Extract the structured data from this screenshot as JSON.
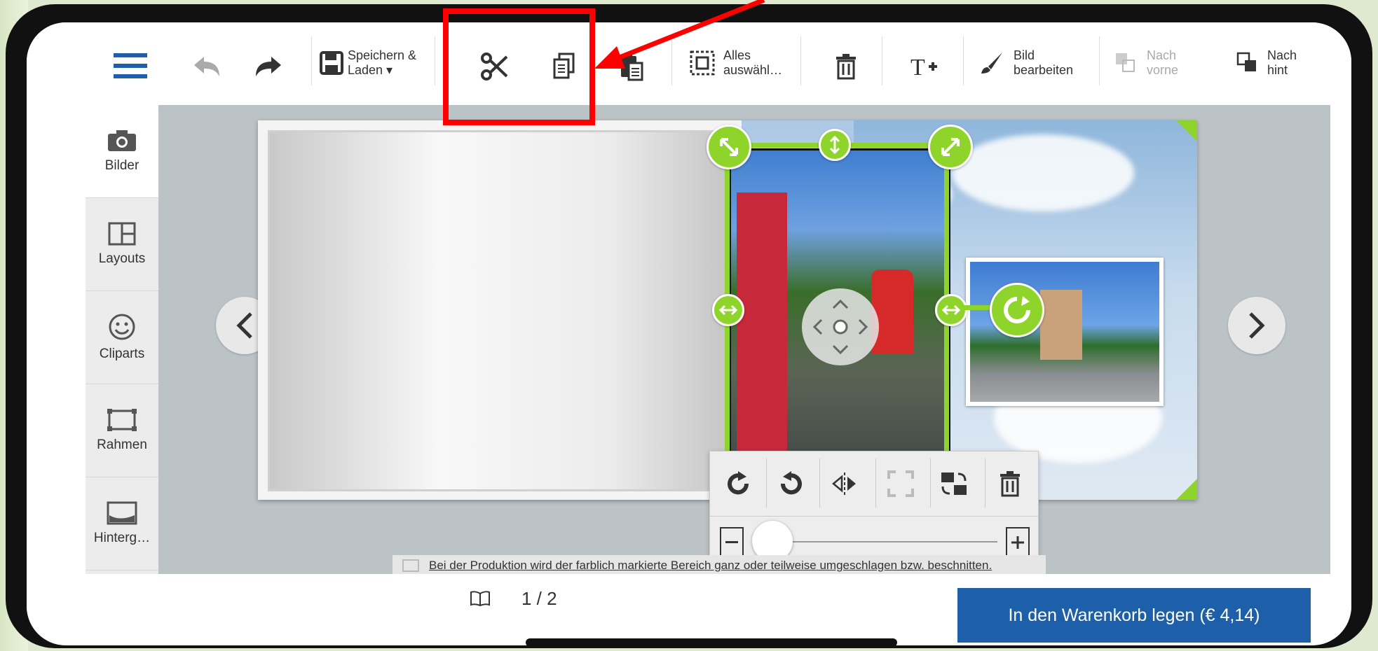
{
  "toolbar": {
    "menu_icon": "hamburger-icon",
    "undo_icon": "undo-icon",
    "redo_icon": "redo-icon",
    "save_label_1": "Speichern &",
    "save_label_2": "Laden ▾",
    "cut_icon": "scissors-icon",
    "copy_icon": "copy-icon",
    "paste_icon": "paste-icon",
    "select_all_1": "Alles",
    "select_all_2": "auswähl…",
    "delete_icon": "trash-icon",
    "add_text_icon": "add-text-icon",
    "edit_image_1": "Bild",
    "edit_image_2": "bearbeiten",
    "bring_forward_1": "Nach",
    "bring_forward_2": "vorne",
    "send_back_1": "Nach",
    "send_back_2": "hint"
  },
  "sidebar": {
    "items": [
      {
        "label": "Bilder",
        "icon": "camera-icon"
      },
      {
        "label": "Layouts",
        "icon": "layout-icon"
      },
      {
        "label": "Cliparts",
        "icon": "smiley-icon"
      },
      {
        "label": "Rahmen",
        "icon": "frame-icon"
      },
      {
        "label": "Hinterg…",
        "icon": "background-icon"
      }
    ]
  },
  "notice": "Bei der Produktion wird der farblich markierte Bereich ganz oder teilweise umgeschlagen bzw. beschnitten.",
  "pager": {
    "text": "1 / 2"
  },
  "cart_button": "In den Warenkorb legen (€ 4,14)",
  "colors": {
    "accent_green": "#8fd42b",
    "cart_blue": "#1d5fa8",
    "highlight_red": "#ff0000"
  }
}
